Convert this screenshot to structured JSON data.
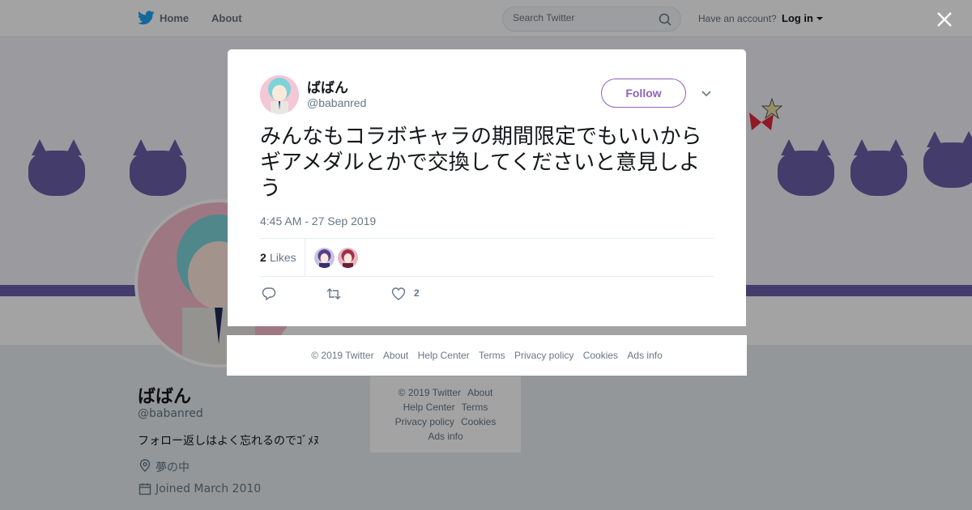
{
  "nav": {
    "home": "Home",
    "about": "About",
    "search_placeholder": "Search Twitter",
    "account_prompt": "Have an account?",
    "login": "Log in"
  },
  "profile": {
    "name": "ばばん",
    "handle": "@babanred",
    "bio": "フォロー返しはよく忘れるのでｺﾞﾒﾇ",
    "location": "夢の中",
    "joined": "Joined March 2010"
  },
  "side_footer": {
    "links": [
      "© 2019 Twitter",
      "About",
      "Help Center",
      "Terms",
      "Privacy policy",
      "Cookies",
      "Ads info"
    ]
  },
  "tweet": {
    "author_name": "ばばん",
    "author_handle": "@babanred",
    "follow_label": "Follow",
    "text": "みんなもコラボキャラの期間限定でもいいからギアメダルとかで交換してくださいと意見しよう",
    "timestamp": "4:45 AM - 27 Sep 2019",
    "likes_count": "2",
    "likes_label": "Likes",
    "like_action_count": "2"
  },
  "modal_footer": {
    "links": [
      "© 2019 Twitter",
      "About",
      "Help Center",
      "Terms",
      "Privacy policy",
      "Cookies",
      "Ads info"
    ]
  },
  "colors": {
    "accent": "#8f62b9",
    "banner_purple": "#6b5fa8",
    "twitter_blue": "#1da1f2"
  }
}
